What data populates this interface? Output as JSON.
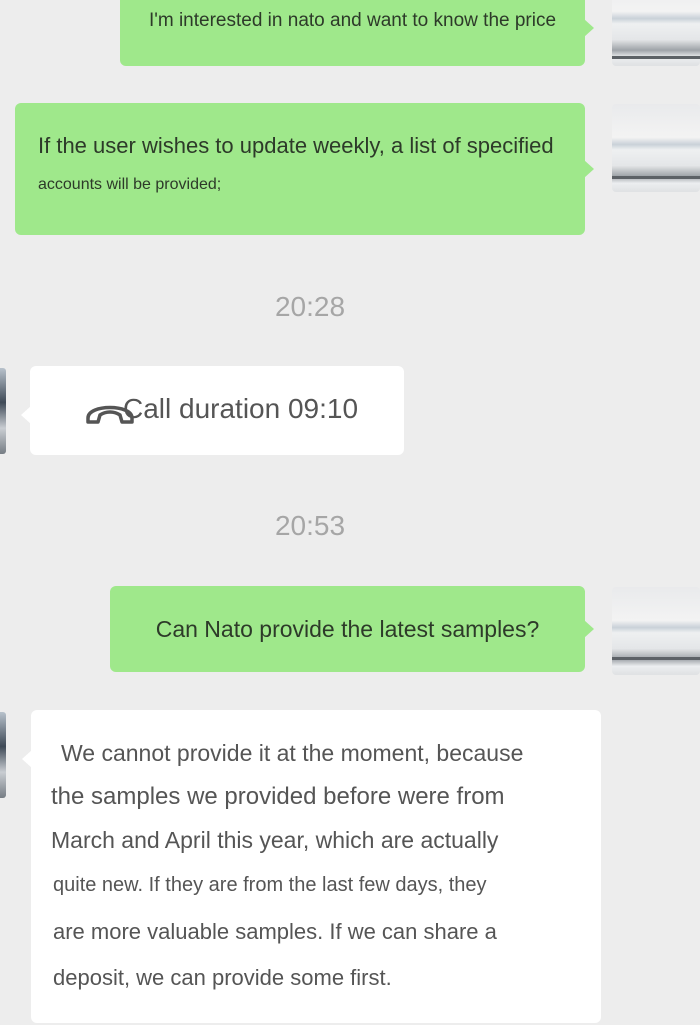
{
  "messages": [
    {
      "from": "me",
      "text": "I'm interested in nato and want to know the price"
    },
    {
      "from": "me",
      "lines": [
        "If the user wishes to update weekly, a list of specified",
        "accounts will be provided;"
      ]
    },
    {
      "from": "system",
      "text": "20:28"
    },
    {
      "from": "them",
      "type": "call",
      "icon": "phone-hangup-icon",
      "text": "Call duration 09:10"
    },
    {
      "from": "system",
      "text": "20:53"
    },
    {
      "from": "me",
      "text": "Can Nato provide the latest samples?"
    },
    {
      "from": "them",
      "lines": [
        "We cannot provide it at the moment, because",
        "the samples we provided before were from",
        "March and April this year, which are actually",
        "quite new. If they are from the last few days, they",
        "are more valuable samples. If we can share a",
        "deposit, we can provide some first."
      ]
    }
  ],
  "colors": {
    "outgoing_bubble": "#9fe88b",
    "incoming_bubble": "#ffffff",
    "background": "#ededed",
    "timestamp": "#a6a6a6"
  }
}
